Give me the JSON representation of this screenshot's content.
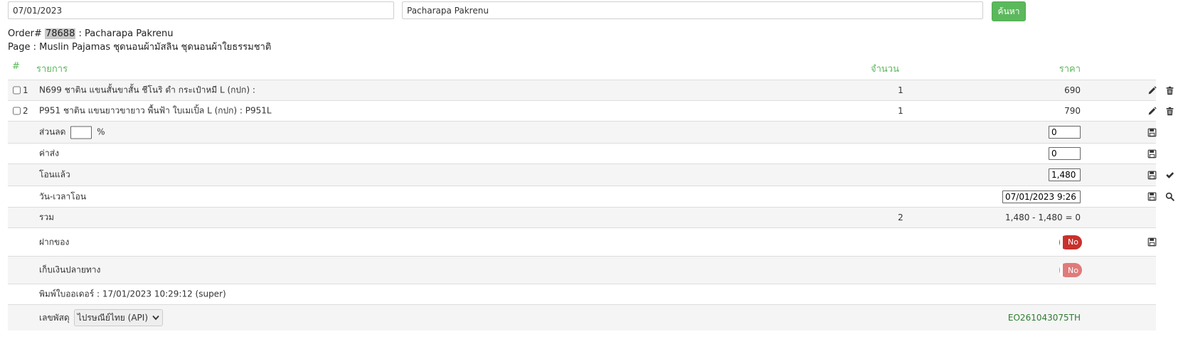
{
  "search": {
    "date_value": "07/01/2023",
    "name_value": "Pacharapa Pakrenu",
    "button_label": "ค้นหา"
  },
  "order": {
    "prefix": "Order#",
    "number": "78688",
    "customer": ": Pacharapa Pakrenu",
    "page_line": "Page : Muslin Pajamas ชุดนอนผ้ามัสลิน ชุดนอนผ้าใยธรรมชาติ"
  },
  "table": {
    "headers": {
      "num": "#",
      "item": "รายการ",
      "qty": "จำนวน",
      "price": "ราคา"
    },
    "items": [
      {
        "num": "1",
        "desc": "N699 ชาติน แขนสั้นขาสั้น ชีโนริ ดำ กระเป๋าหมี L (กปก) :",
        "qty": "1",
        "price": "690"
      },
      {
        "num": "2",
        "desc": "P951 ชาติน แขนยาวขายาว พื้นฟ้า ใบเมเปิ้ล L (กปก) : P951L",
        "qty": "1",
        "price": "790"
      }
    ],
    "discount": {
      "label": "ส่วนลด",
      "percent_value": "",
      "percent_sign": "%",
      "value": "0"
    },
    "shipping": {
      "label": "ค่าส่ง",
      "value": "0"
    },
    "transferred": {
      "label": "โอนแล้ว",
      "value": "1,480"
    },
    "transfer_time": {
      "label": "วัน-เวลาโอน",
      "value": "07/01/2023 9:26"
    },
    "total": {
      "label": "รวม",
      "qty": "2",
      "summary": "1,480 - 1,480 = 0"
    },
    "deposit": {
      "label": "ฝากของ",
      "toggle": "No"
    },
    "cod": {
      "label": "เก็บเงินปลายทาง",
      "toggle": "No"
    },
    "printed": {
      "text": "พิมพ์ใบออเดอร์ : 17/01/2023 10:29:12 (super)"
    },
    "parcel": {
      "label": "เลขพัสดุ",
      "carrier": "ไปรษณีย์ไทย (API)",
      "tracking": "EO261043075TH"
    }
  },
  "colors": {
    "accent": "#5cb85c",
    "danger": "#c9302c",
    "stripe": "#f5f5f5",
    "tracking": "#2e7d32"
  },
  "icons": [
    "pencil-icon",
    "trash-icon",
    "save-icon",
    "check-icon",
    "search-icon",
    "chevron-down-icon"
  ]
}
